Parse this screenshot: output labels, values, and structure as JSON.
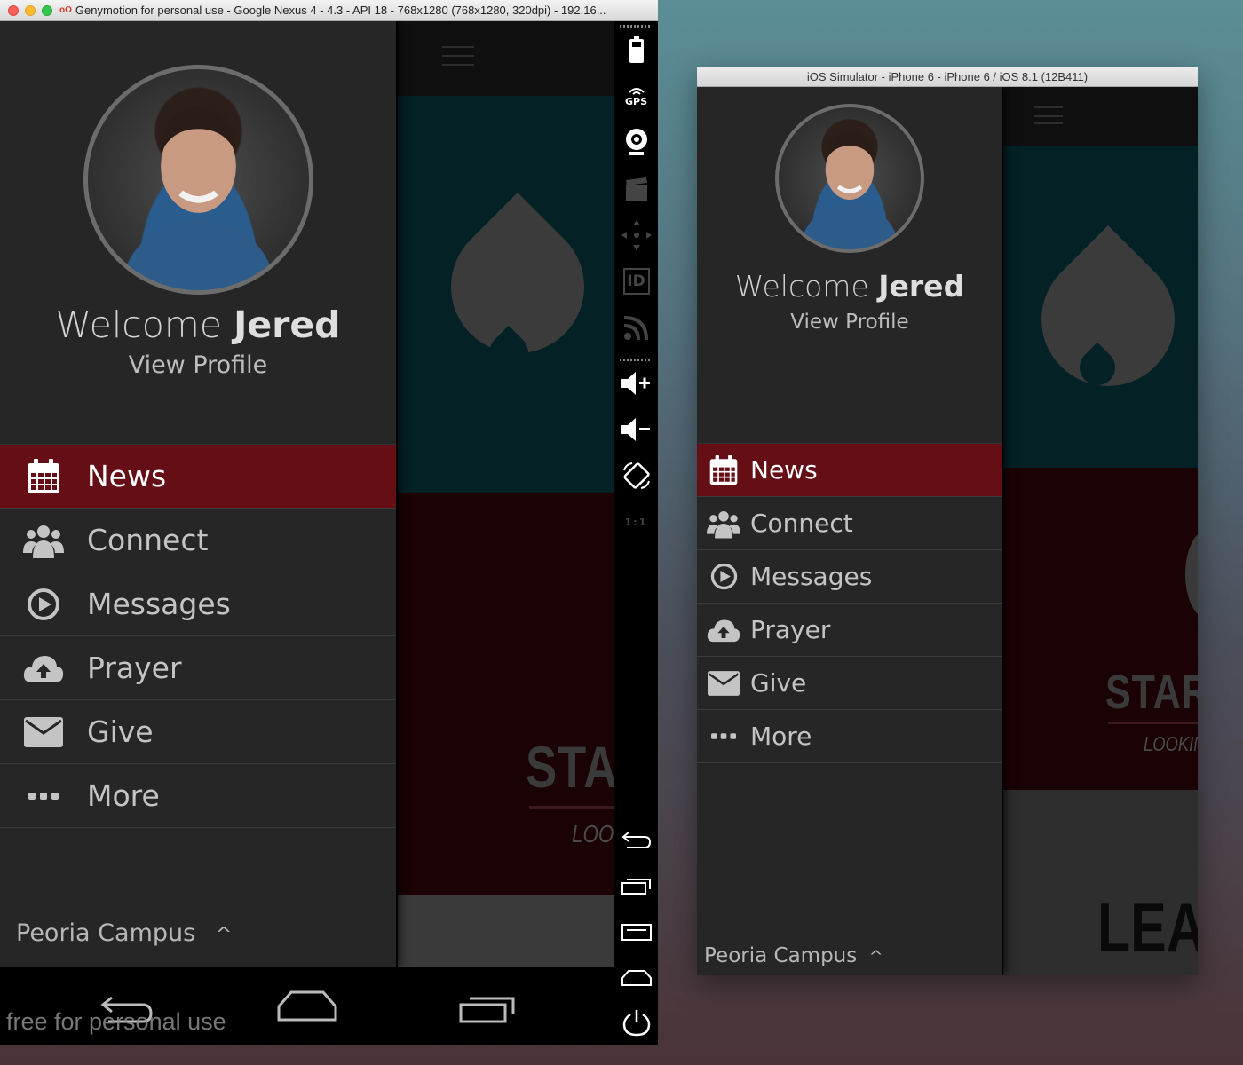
{
  "android": {
    "window_title": "Genymotion for personal use - Google Nexus 4 - 4.3 - API 18 - 768x1280 (768x1280, 320dpi) - 192.16...",
    "welcome_prefix": "Welcome",
    "user_name": "Jered",
    "view_profile": "View Profile",
    "menu": [
      {
        "label": "News",
        "icon": "calendar-icon",
        "active": true
      },
      {
        "label": "Connect",
        "icon": "users-icon",
        "active": false
      },
      {
        "label": "Messages",
        "icon": "play-circle-icon",
        "active": false
      },
      {
        "label": "Prayer",
        "icon": "cloud-upload-icon",
        "active": false
      },
      {
        "label": "Give",
        "icon": "envelope-icon",
        "active": false
      },
      {
        "label": "More",
        "icon": "ellipsis-icon",
        "active": false
      }
    ],
    "campus": "Peoria Campus",
    "campus_caret": "^",
    "bg_text_big": "STA",
    "bg_text_small": "LOOK",
    "gps_label": "GPS",
    "id_label": "ID",
    "ratio_label": "1:1",
    "watermark": "free for personal use"
  },
  "ios": {
    "window_title": "iOS Simulator - iPhone 6 - iPhone 6 / iOS 8.1 (12B411)",
    "welcome_prefix": "Welcome",
    "user_name": "Jered",
    "view_profile": "View Profile",
    "menu": [
      {
        "label": "News",
        "icon": "calendar-icon",
        "active": true
      },
      {
        "label": "Connect",
        "icon": "users-icon",
        "active": false
      },
      {
        "label": "Messages",
        "icon": "play-circle-icon",
        "active": false
      },
      {
        "label": "Prayer",
        "icon": "cloud-upload-icon",
        "active": false
      },
      {
        "label": "Give",
        "icon": "envelope-icon",
        "active": false
      },
      {
        "label": "More",
        "icon": "ellipsis-icon",
        "active": false
      }
    ],
    "campus": "Peoria Campus",
    "campus_caret": "^",
    "bg_text_big": "STAR",
    "bg_text_small": "LOOKING",
    "bg_text_bottom": "LEAI"
  },
  "colors": {
    "drawer_bg": "#262626",
    "active_item": "#650e15",
    "teal_panel": "#042126",
    "dark_red_panel": "#1b0305"
  }
}
